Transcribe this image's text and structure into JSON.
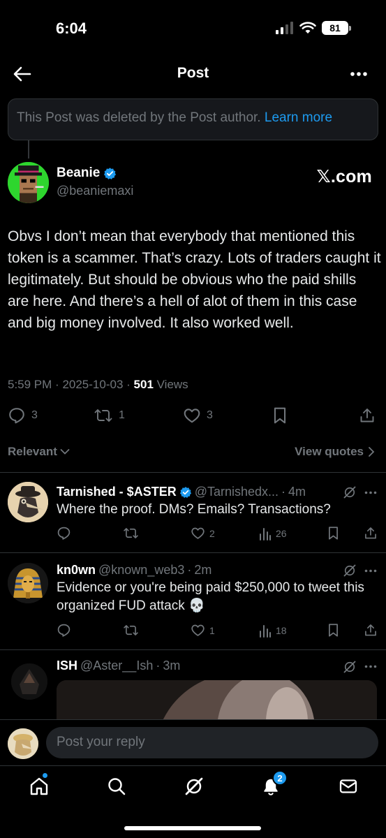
{
  "status_bar": {
    "time": "6:04",
    "battery": "81"
  },
  "header": {
    "title": "Post"
  },
  "deleted_notice": {
    "text": "This Post was deleted by the Post author.",
    "link": "Learn more"
  },
  "post": {
    "author_name": "Beanie",
    "author_handle": "@beaniemaxi",
    "watermark": "𝕏.com",
    "text": "Obvs I don’t mean that everybody that mentioned this token is a scammer. That’s crazy. Lots of traders caught it legitimately. But should be obvious who the paid shills are here. And there’s a hell of alot of them in this case and big money involved. It also worked well.",
    "time": "5:59 PM",
    "date": "2025-10-03",
    "views_count": "501",
    "views_label": "Views",
    "reply_count": "3",
    "repost_count": "1",
    "like_count": "3"
  },
  "sort": {
    "label": "Relevant",
    "view_quotes": "View quotes"
  },
  "replies": [
    {
      "name": "Tarnished - $ASTER",
      "handle": "@Tarnishedx...",
      "time": "4m",
      "text": "Where the proof. DMs? Emails? Transactions?",
      "reply_count": "",
      "repost_count": "",
      "like_count": "2",
      "view_count": "26"
    },
    {
      "name": "kn0wn",
      "handle": "@known_web3",
      "time": "2m",
      "text": "Evidence or you're being paid $250,000 to tweet this organized FUD attack 💀",
      "reply_count": "",
      "repost_count": "",
      "like_count": "1",
      "view_count": "18"
    },
    {
      "name": "ISH",
      "handle": "@Aster__Ish",
      "time": "3m",
      "text": ""
    }
  ],
  "compose": {
    "placeholder": "Post your reply"
  },
  "nav": {
    "notifications_badge": "2"
  },
  "colors": {
    "accent": "#1d9bf0",
    "muted": "#71767b",
    "background": "#000000"
  }
}
